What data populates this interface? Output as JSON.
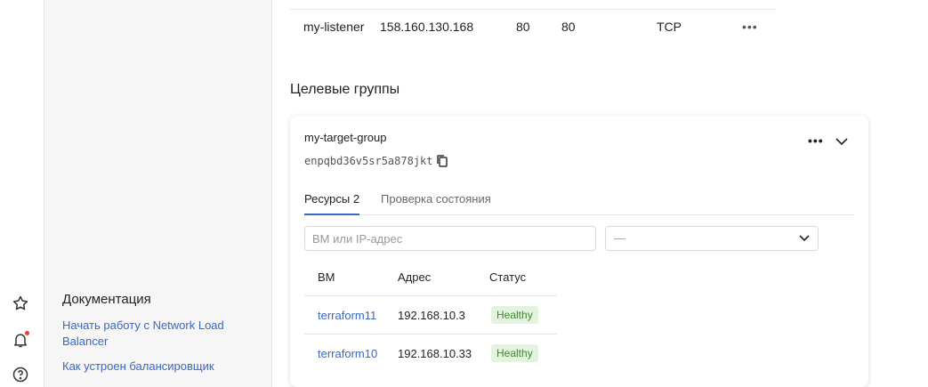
{
  "listener": {
    "name": "my-listener",
    "address": "158.160.130.168",
    "port": "80",
    "target_port": "80",
    "protocol": "TCP",
    "more": "•••"
  },
  "section_title": "Целевые группы",
  "target_group": {
    "name": "my-target-group",
    "id": "enpqbd36v5sr5a878jkt",
    "dots": "•••",
    "tabs": [
      {
        "label": "Ресурсы 2",
        "active": true
      },
      {
        "label": "Проверка состояния",
        "active": false
      }
    ],
    "search_placeholder": "ВМ или IP-адрес",
    "select_value": "—",
    "table": {
      "headers": [
        "ВМ",
        "Адрес",
        "Статус"
      ],
      "rows": [
        {
          "vm": "terraform11",
          "address": "192.168.10.3",
          "status": "Healthy"
        },
        {
          "vm": "terraform10",
          "address": "192.168.10.33",
          "status": "Healthy"
        }
      ]
    }
  },
  "docs": {
    "title": "Документация",
    "links": [
      "Начать работу с Network Load Balancer",
      "Как устроен балансировщик"
    ]
  },
  "colors": {
    "link": "#3a67c8",
    "healthy_bg": "#e2f4dd",
    "healthy_text": "#3c8a2e",
    "notification_dot": "#e8402c"
  },
  "icons": {
    "rail": [
      "star-icon",
      "bell-icon",
      "help-icon"
    ]
  }
}
